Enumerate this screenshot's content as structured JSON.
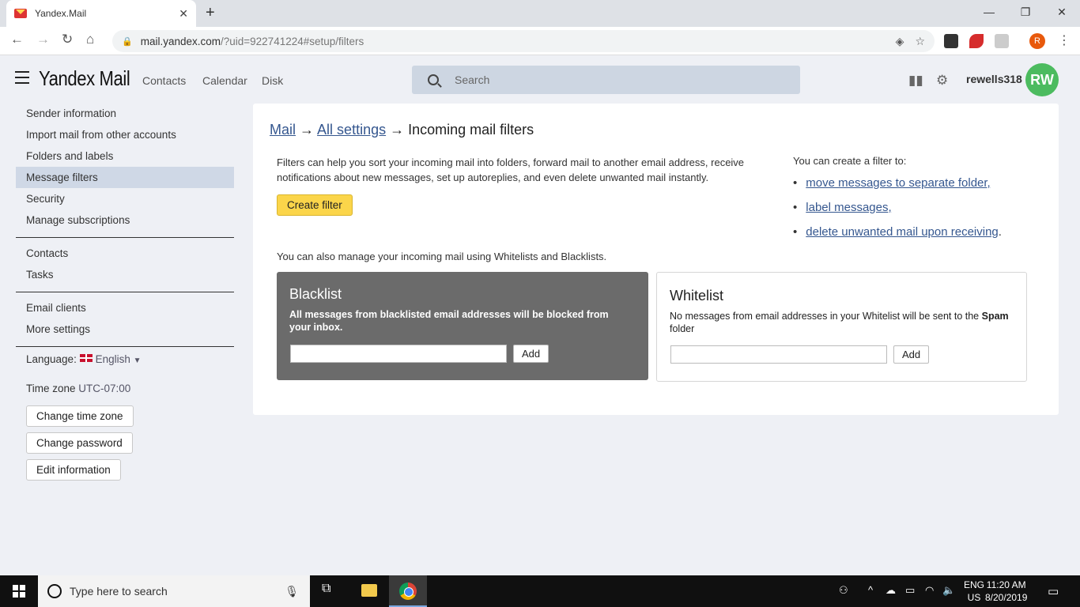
{
  "browser": {
    "tab_title": "Yandex.Mail",
    "url_host": "mail.yandex.com",
    "url_rest": "/?uid=922741224#setup/filters",
    "profile_letter": "R"
  },
  "header": {
    "logo": "Yandex Mail",
    "nav": [
      "Contacts",
      "Calendar",
      "Disk"
    ],
    "search_placeholder": "Search",
    "username": "rewells318",
    "avatar_initials": "RW"
  },
  "sidebar": {
    "group1": [
      "Sender information",
      "Import mail from other accounts",
      "Folders and labels",
      "Message filters",
      "Security",
      "Manage subscriptions"
    ],
    "active_item": "Message filters",
    "group2": [
      "Contacts",
      "Tasks"
    ],
    "group3": [
      "Email clients",
      "More settings"
    ],
    "language_label": "Language:",
    "language_value": "English",
    "timezone_label": "Time zone",
    "timezone_value": "UTC-07:00",
    "buttons": [
      "Change time zone",
      "Change password",
      "Edit information"
    ]
  },
  "main": {
    "breadcrumb_mail": "Mail",
    "breadcrumb_settings": "All settings",
    "breadcrumb_current": "Incoming mail filters",
    "intro": "Filters can help you sort your incoming mail into folders, forward mail to another email address, receive notifications about new messages, set up autoreplies, and even delete unwanted mail instantly.",
    "create_filter": "Create filter",
    "can_create": "You can create a filter to:",
    "filter_links": [
      "move messages to separate folder,",
      "label messages,",
      "delete unwanted mail upon receiving"
    ],
    "also_manage": "You can also manage your incoming mail using Whitelists and Blacklists.",
    "blacklist": {
      "title": "Blacklist",
      "desc": "All messages from blacklisted email addresses will be blocked from your inbox.",
      "add": "Add"
    },
    "whitelist": {
      "title": "Whitelist",
      "desc_pre": "No messages from email addresses in your Whitelist will be sent to the",
      "desc_bold": "Spam",
      "desc_post": "folder",
      "add": "Add"
    }
  },
  "taskbar": {
    "search_placeholder": "Type here to search",
    "lang_top": "ENG",
    "lang_bottom": "US",
    "time": "11:20 AM",
    "date": "8/20/2019"
  },
  "colors": {
    "accent_yellow": "#fbd54a",
    "link": "#35578f",
    "avatar": "#4cbb5f",
    "blacklist_bg": "#6b6b6b"
  }
}
